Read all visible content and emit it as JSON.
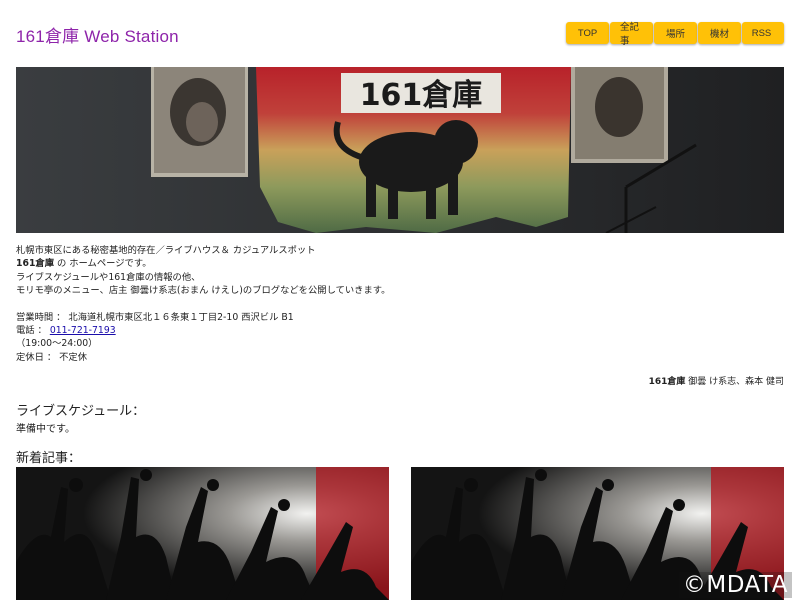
{
  "site": {
    "title": "161倉庫 Web Station"
  },
  "nav": [
    {
      "label": "TOP"
    },
    {
      "label": "全記事"
    },
    {
      "label": "場所"
    },
    {
      "label": "機材"
    },
    {
      "label": "RSS",
      "icon": "rss-icon"
    }
  ],
  "hero": {
    "banner_text": "161倉庫",
    "image": "hero-stage-image"
  },
  "intro": {
    "line1": "札幌市東区にある秘密基地的存在／ライブハウス＆ カジュアルスポット",
    "line2_bold": "161倉庫",
    "line2_rest": " の ホームページです。",
    "line3": "ライブスケジュールや161倉庫の情報の他、",
    "line4": "モリモ亭のメニュー、店主 御曇け系志(おまん けえし)のブログなどを公開していきます。",
    "hours": "営業時間 ： 北海道札幌市東区北１６条東１丁目2-10 西沢ビル B1",
    "phone_label": "電話 ： ",
    "phone": "011-721-7193",
    "time": "（19:00～24:00）",
    "holiday": "定休日 ： 不定休"
  },
  "credit": {
    "bold": "161倉庫",
    "rest": " 御曇 け系志、森本 健司"
  },
  "schedule": {
    "heading": "ライブスケジュール：",
    "text": "準備中です。"
  },
  "news": {
    "heading": "新着記事："
  },
  "watermark": "©MDATA",
  "colors": {
    "accent": "#8e24aa",
    "nav_bg": "#ffc107",
    "link": "#1a0dab"
  }
}
